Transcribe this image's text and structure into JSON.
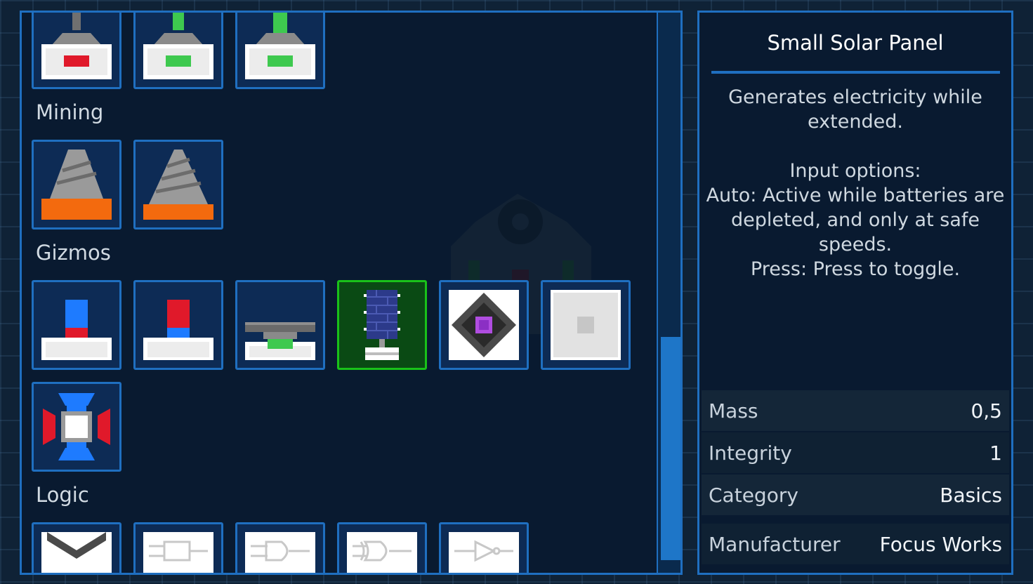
{
  "palette": {
    "sections": [
      {
        "label": "Mining"
      },
      {
        "label": "Gizmos"
      },
      {
        "label": "Logic"
      }
    ],
    "tiles": {
      "top_row": [
        "red-light-button-icon",
        "green-light-button-icon",
        "tall-green-light-button-icon"
      ],
      "mining": [
        "small-drill-icon",
        "large-drill-icon"
      ],
      "gizmos": [
        "blue-red-piston-icon",
        "red-blue-piston-icon",
        "pressure-plate-icon",
        "small-solar-panel-icon",
        "diamond-sensor-icon",
        "gray-block-icon",
        "thruster-cross-icon"
      ],
      "logic": [
        "v-gate-icon",
        "logic-gate-1-icon",
        "logic-gate-2-icon",
        "logic-gate-3-icon",
        "logic-gate-4-icon"
      ],
      "selected": "small-solar-panel-icon"
    }
  },
  "info": {
    "title": "Small Solar Panel",
    "description": "Generates electricity while\nextended.\n\nInput options:\nAuto: Active while batteries are\ndepleted, and only at safe\nspeeds.\nPress: Press to toggle.",
    "stats": [
      {
        "label": "Mass",
        "value": "0,5"
      },
      {
        "label": "Integrity",
        "value": "1"
      },
      {
        "label": "Category",
        "value": "Basics"
      },
      {
        "label": "Manufacturer",
        "value": "Focus Works"
      }
    ]
  },
  "colors": {
    "accent": "#1f6fc0",
    "selected": "#19c219",
    "panel_bg": "#091a30"
  }
}
